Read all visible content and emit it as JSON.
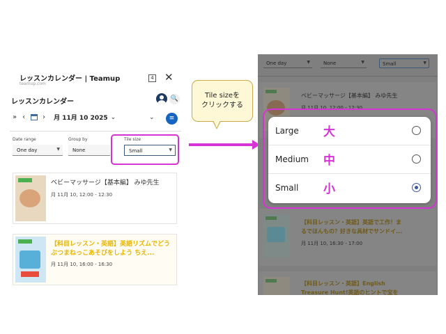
{
  "left_panel": {
    "app_title": "レッスンカレンダー | Teamup",
    "app_subtitle": "teamup.com",
    "tab_icon": "4",
    "close_icon": "✕",
    "calendar_title": "レッスンカレンダー",
    "search_icon": "🔍",
    "nav": {
      "skip": "»",
      "prev": "‹",
      "next": "›",
      "date": "月 11月 10 2025",
      "date_chevron": "⌄",
      "chevron": "⌄",
      "menu_icon": "≡"
    },
    "filters": [
      {
        "label": "Date range",
        "value": "One day"
      },
      {
        "label": "Group by",
        "value": "None"
      },
      {
        "label": "Tile size",
        "value": "Small"
      }
    ],
    "cards": [
      {
        "title": "ベビーマッサージ【基本編】 みゆ先生",
        "time": "月 11月 10, 12:00 - 12:30"
      },
      {
        "title": "【科目レッスン・英語】英語リズムでどうぶつまねっこあそびをしよう ちえ...",
        "time": "月 11月 10, 16:00 - 16:30"
      }
    ]
  },
  "callout": {
    "line1": "Tile sizeを",
    "line2": "クリックする"
  },
  "right_panel": {
    "filters": [
      "One day",
      "None",
      "Small"
    ],
    "cards": [
      {
        "title_l1": "ベビーマッサージ【基本編】 みゆ先生",
        "time": "月 11月 10, 12:00 - 12:30"
      },
      {
        "title_l1": "【科目レッスン・英語】英語で工作！ま",
        "title_l2": "るでほんもの？好きな具材でサンドイ...",
        "time": "月 11月 10, 16:30 - 17:00"
      },
      {
        "title_l1": "【科目レッスン・英語】English",
        "title_l2": "Treasure Hunt!英語のヒントで宝を"
      }
    ],
    "popup": {
      "options": [
        {
          "label": "Large",
          "kanji": "大",
          "selected": false
        },
        {
          "label": "Medium",
          "kanji": "中",
          "selected": false
        },
        {
          "label": "Small",
          "kanji": "小",
          "selected": true
        }
      ]
    }
  },
  "colors": {
    "highlight": "#d633d6",
    "accent": "#1565c0",
    "callout_bg": "#fff8d6",
    "card_title_yellow": "#e8b400"
  }
}
